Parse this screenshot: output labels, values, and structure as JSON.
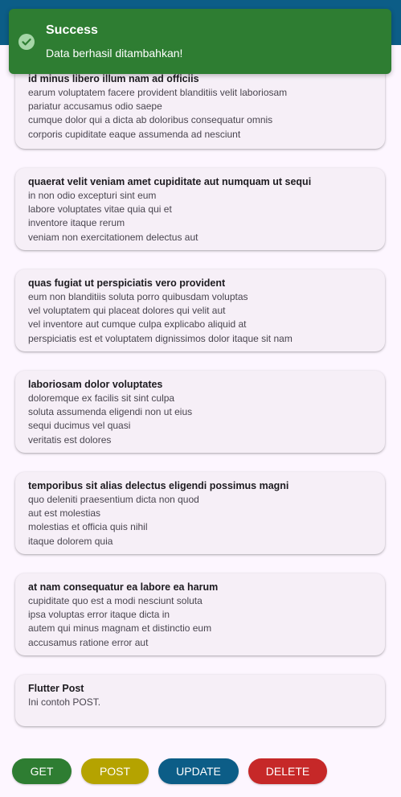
{
  "colors": {
    "appbar": "#0c5d87",
    "toast": "#2e7d32",
    "get": "#2e7d32",
    "post": "#b5a300",
    "update": "#0c5d87",
    "delete": "#c62828"
  },
  "toast": {
    "icon": "check-circle-icon",
    "title": "Success",
    "message": "Data berhasil ditambahkan!"
  },
  "posts": [
    {
      "title": "id minus libero illum nam ad officiis",
      "body": "earum voluptatem facere provident blanditiis velit laboriosam\npariatur accusamus odio saepe\ncumque dolor qui a dicta ab doloribus consequatur omnis\ncorporis cupiditate eaque assumenda ad nesciunt"
    },
    {
      "title": "quaerat velit veniam amet cupiditate aut numquam ut sequi",
      "body": "in non odio excepturi sint eum\nlabore voluptates vitae quia qui et\ninventore itaque rerum\nveniam non exercitationem delectus aut"
    },
    {
      "title": "quas fugiat ut perspiciatis vero provident",
      "body": "eum non blanditiis soluta porro quibusdam voluptas\nvel voluptatem qui placeat dolores qui velit aut\nvel inventore aut cumque culpa explicabo aliquid at\nperspiciatis est et voluptatem dignissimos dolor itaque sit nam"
    },
    {
      "title": "laboriosam dolor voluptates",
      "body": "doloremque ex facilis sit sint culpa\nsoluta assumenda eligendi non ut eius\nsequi ducimus vel quasi\nveritatis est dolores"
    },
    {
      "title": "temporibus sit alias delectus eligendi possimus magni",
      "body": "quo deleniti praesentium dicta non quod\naut est molestias\nmolestias et officia quis nihil\nitaque dolorem quia"
    },
    {
      "title": "at nam consequatur ea labore ea harum",
      "body": "cupiditate quo est a modi nesciunt soluta\nipsa voluptas error itaque dicta in\nautem qui minus magnam et distinctio eum\naccusamus ratione error aut"
    },
    {
      "title": "Flutter Post",
      "body": "Ini contoh POST."
    }
  ],
  "buttons": {
    "get": "GET",
    "post": "POST",
    "update": "UPDATE",
    "delete": "DELETE"
  }
}
